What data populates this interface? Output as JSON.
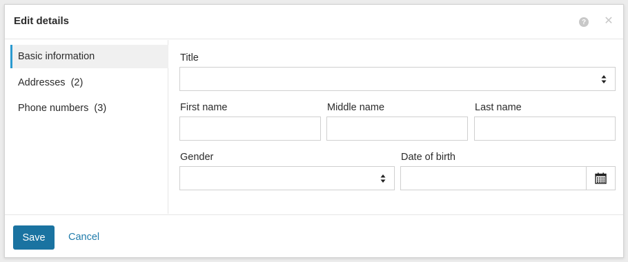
{
  "dialog": {
    "title": "Edit details",
    "help_icon": "question-circle-icon",
    "close_icon": "close-icon"
  },
  "sidebar": {
    "items": [
      {
        "label": "Basic information",
        "active": true
      },
      {
        "label": "Addresses  (2)",
        "active": false
      },
      {
        "label": "Phone numbers  (3)",
        "active": false
      }
    ]
  },
  "form": {
    "title_label": "Title",
    "title_value": "",
    "first_name_label": "First name",
    "first_name_value": "",
    "middle_name_label": "Middle name",
    "middle_name_value": "",
    "last_name_label": "Last name",
    "last_name_value": "",
    "gender_label": "Gender",
    "gender_value": "",
    "dob_label": "Date of birth",
    "dob_value": "",
    "calendar_icon": "calendar-icon"
  },
  "footer": {
    "save_label": "Save",
    "cancel_label": "Cancel"
  },
  "colors": {
    "accent": "#2a9ad0",
    "primary_button": "#1a73a1",
    "link": "#1f7bab"
  }
}
